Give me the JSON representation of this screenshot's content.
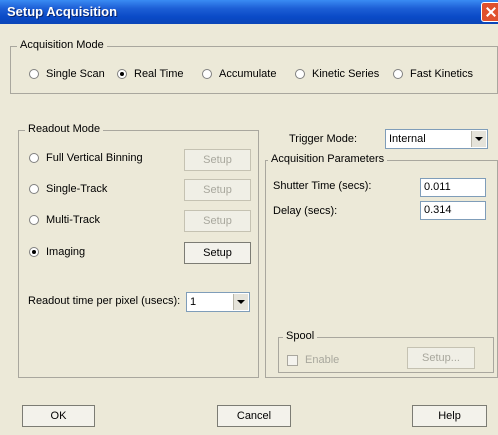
{
  "window": {
    "title": "Setup Acquisition"
  },
  "acquisition_mode": {
    "title": "Acquisition Mode",
    "options": [
      {
        "label": "Single Scan",
        "selected": false
      },
      {
        "label": "Real Time",
        "selected": true
      },
      {
        "label": "Accumulate",
        "selected": false
      },
      {
        "label": "Kinetic Series",
        "selected": false
      },
      {
        "label": "Fast Kinetics",
        "selected": false
      }
    ]
  },
  "readout_mode": {
    "title": "Readout Mode",
    "options": [
      {
        "label": "Full Vertical Binning",
        "selected": false,
        "button": "Setup",
        "button_enabled": false
      },
      {
        "label": "Single-Track",
        "selected": false,
        "button": "Setup",
        "button_enabled": false
      },
      {
        "label": "Multi-Track",
        "selected": false,
        "button": "Setup",
        "button_enabled": false
      },
      {
        "label": "Imaging",
        "selected": true,
        "button": "Setup",
        "button_enabled": true
      }
    ],
    "readout_time_label": "Readout time per pixel (usecs):",
    "readout_time_value": "1"
  },
  "trigger": {
    "label": "Trigger Mode:",
    "value": "Internal"
  },
  "acquisition_parameters": {
    "title": "Acquisition Parameters",
    "shutter_label": "Shutter Time (secs):",
    "shutter_value": "0.011",
    "delay_label": "Delay (secs):",
    "delay_value": "0.314"
  },
  "spool": {
    "title": "Spool",
    "enable_label": "Enable",
    "enable_checked": false,
    "setup_label": "Setup..."
  },
  "buttons": {
    "ok": "OK",
    "cancel": "Cancel",
    "help": "Help"
  }
}
